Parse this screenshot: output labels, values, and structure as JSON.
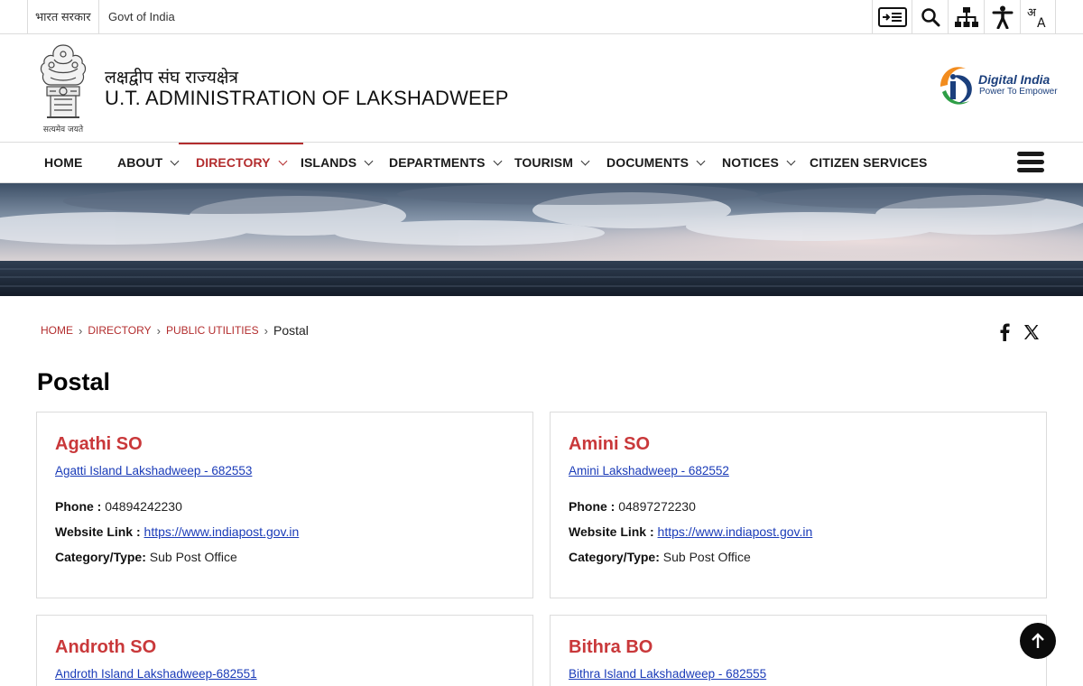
{
  "topbar": {
    "gov_hindi": "भारत सरकार",
    "gov_english": "Govt of India",
    "tools": [
      {
        "icon": "skip-to-content-icon"
      },
      {
        "icon": "search-icon"
      },
      {
        "icon": "sitemap-icon"
      },
      {
        "icon": "accessibility-icon"
      },
      {
        "icon": "language-icon"
      }
    ]
  },
  "header": {
    "title_hindi": "लक्षद्वीप संघ राज्यक्षेत्र",
    "title_english": "U.T. ADMINISTRATION OF LAKSHADWEEP",
    "emblem_caption": "सत्यमेव जयते",
    "digital_india_title": "Digital India",
    "digital_india_tagline": "Power To Empower"
  },
  "nav": {
    "items": [
      {
        "label": "HOME"
      },
      {
        "label": "ABOUT"
      },
      {
        "label": "DIRECTORY"
      },
      {
        "label": "ISLANDS"
      },
      {
        "label": "DEPARTMENTS"
      },
      {
        "label": "TOURISM"
      },
      {
        "label": "DOCUMENTS"
      },
      {
        "label": "NOTICES"
      },
      {
        "label": "CITIZEN SERVICES"
      }
    ],
    "active": "DIRECTORY"
  },
  "breadcrumb": {
    "items": [
      "HOME",
      "DIRECTORY",
      "PUBLIC UTILITIES"
    ],
    "current": "Postal"
  },
  "page": {
    "title": "Postal"
  },
  "labels": {
    "phone": "Phone :",
    "website": "Website Link :",
    "category": "Category/Type:"
  },
  "cards": [
    {
      "name": "Agathi SO",
      "address": "Agatti Island Lakshadweep - 682553",
      "phone": "04894242230",
      "website": "https://www.indiapost.gov.in",
      "category": "Sub Post Office"
    },
    {
      "name": "Amini SO",
      "address": "Amini Lakshadweep - 682552",
      "phone": "04897272230",
      "website": "https://www.indiapost.gov.in",
      "category": "Sub Post Office"
    },
    {
      "name": "Androth SO",
      "address": "Androth Island Lakshadweep-682551"
    },
    {
      "name": "Bithra BO",
      "address": "Bithra Island Lakshadweep - 682555"
    }
  ],
  "colors": {
    "accent_red": "#b32d2e",
    "card_title_red": "#c9383a",
    "link_blue": "#1a3bb8",
    "digital_india_blue": "#1b3f7c"
  }
}
